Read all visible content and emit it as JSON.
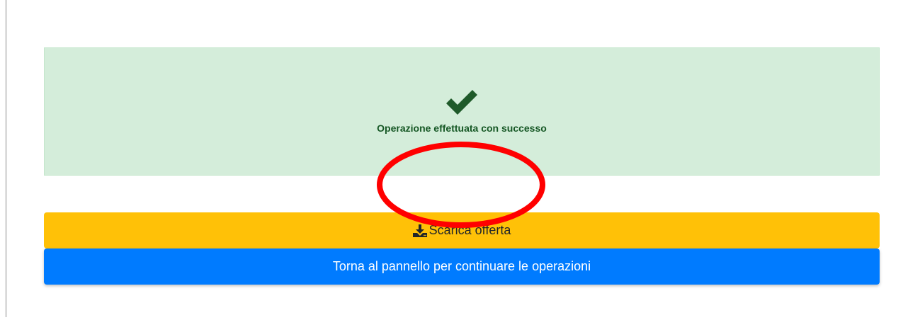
{
  "alert": {
    "icon": "check-icon",
    "message": "Operazione effettuata con successo",
    "background": "#d4edda",
    "text_color": "#155724"
  },
  "actions": {
    "download": {
      "icon": "download-icon",
      "label": "Scarica offerta",
      "color": "#ffc107"
    },
    "back": {
      "label": "Torna al pannello per continuare le operazioni",
      "color": "#007bff"
    }
  },
  "annotation": {
    "shape": "ellipse",
    "color": "#ff0000"
  }
}
